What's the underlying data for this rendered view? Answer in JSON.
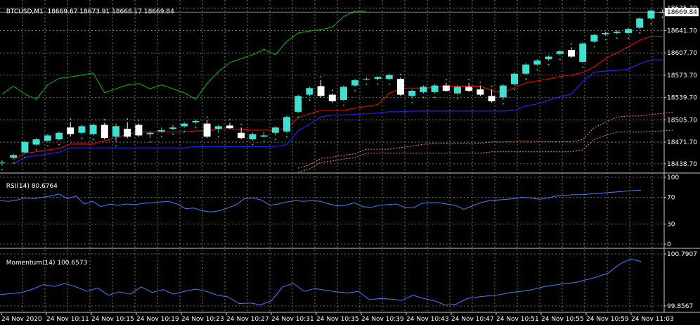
{
  "chart_data": [
    {
      "type": "candlestick",
      "title": "BTCUSD,M1  18669.67 18673.91 18668.17 18669.84",
      "current_price_label": "18669.84",
      "ylim": [
        18430,
        18685
      ],
      "y_ticks": [
        "18675.70",
        "18641.70",
        "18607.70",
        "18573.70",
        "18539.70",
        "18505.70",
        "18471.70",
        "18438.70"
      ],
      "series": [
        {
          "name": "BTCUSD,M1",
          "type": "candlestick",
          "ohlc": [
            [
              18440,
              18444,
              18436,
              18441
            ],
            [
              18448,
              18454,
              18446,
              18452
            ],
            [
              18456,
              18474,
              18454,
              18472
            ],
            [
              18468,
              18478,
              18466,
              18476
            ],
            [
              18474,
              18484,
              18472,
              18482
            ],
            [
              18476,
              18488,
              18474,
              18486
            ],
            [
              18494,
              18502,
              18480,
              18484
            ],
            [
              18486,
              18498,
              18484,
              18496
            ],
            [
              18484,
              18500,
              18482,
              18498
            ],
            [
              18498,
              18501,
              18476,
              18478
            ],
            [
              18480,
              18500,
              18472,
              18496
            ],
            [
              18492,
              18502,
              18478,
              18480
            ],
            [
              18498,
              18500,
              18480,
              18482
            ],
            [
              18484,
              18488,
              18478,
              18486
            ],
            [
              18488,
              18494,
              18486,
              18490
            ],
            [
              18492,
              18498,
              18490,
              18494
            ],
            [
              18496,
              18502,
              18494,
              18500
            ],
            [
              18502,
              18506,
              18500,
              18504
            ],
            [
              18500,
              18505,
              18478,
              18480
            ],
            [
              18492,
              18498,
              18486,
              18496
            ],
            [
              18497,
              18501,
              18492,
              18493
            ],
            [
              18486,
              18494,
              18476,
              18478
            ],
            [
              18476,
              18486,
              18474,
              18484
            ],
            [
              18480,
              18488,
              18479,
              18482
            ],
            [
              18486,
              18496,
              18482,
              18494
            ],
            [
              18488,
              18512,
              18486,
              18510
            ],
            [
              18518,
              18544,
              18516,
              18542
            ],
            [
              18544,
              18556,
              18542,
              18554
            ],
            [
              18557,
              18566,
              18540,
              18542
            ],
            [
              18544,
              18546,
              18532,
              18534
            ],
            [
              18536,
              18558,
              18534,
              18556
            ],
            [
              18558,
              18568,
              18556,
              18566
            ],
            [
              18568,
              18570,
              18566,
              18568
            ],
            [
              18568,
              18572,
              18566,
              18571
            ],
            [
              18568,
              18576,
              18566,
              18574
            ],
            [
              18568,
              18570,
              18542,
              18544
            ],
            [
              18542,
              18552,
              18538,
              18550
            ],
            [
              18548,
              18558,
              18546,
              18556
            ],
            [
              18548,
              18560,
              18546,
              18558
            ],
            [
              18558,
              18562,
              18548,
              18550
            ],
            [
              18546,
              18558,
              18544,
              18556
            ],
            [
              18556,
              18562,
              18548,
              18550
            ],
            [
              18552,
              18558,
              18542,
              18544
            ],
            [
              18542,
              18552,
              18532,
              18534
            ],
            [
              18540,
              18560,
              18536,
              18558
            ],
            [
              18560,
              18578,
              18558,
              18576
            ],
            [
              18576,
              18592,
              18574,
              18590
            ],
            [
              18590,
              18598,
              18588,
              18596
            ],
            [
              18598,
              18604,
              18596,
              18602
            ],
            [
              18606,
              18612,
              18604,
              18610
            ],
            [
              18612,
              18616,
              18600,
              18602
            ],
            [
              18594,
              18624,
              18592,
              18622
            ],
            [
              18625,
              18637,
              18623,
              18635
            ],
            [
              18636,
              18640,
              18634,
              18638
            ],
            [
              18638,
              18642,
              18636,
              18640
            ],
            [
              18638,
              18646,
              18636,
              18644
            ],
            [
              18646,
              18662,
              18644,
              18660
            ],
            [
              18660,
              18674,
              18658,
              18672
            ],
            [
              18669.67,
              18673.91,
              18668.17,
              18669.84
            ]
          ]
        },
        {
          "name": "Ichimoku Tenkan",
          "color": "#ff0000"
        },
        {
          "name": "Ichimoku Kijun",
          "color": "#0000ff"
        },
        {
          "name": "Chikou Span",
          "color": "#00c000"
        },
        {
          "name": "Senkou Span A/B",
          "color": "#ff8c40"
        },
        {
          "name": "Parabolic SAR",
          "color": "#00ff00"
        }
      ]
    },
    {
      "type": "line",
      "title": "RSI(14) 80.6764",
      "ylim": [
        0,
        100
      ],
      "y_ticks": [
        "100",
        "70",
        "30",
        "0"
      ],
      "series": [
        {
          "name": "RSI(14)",
          "color": "#3f7fff",
          "values": [
            65,
            64,
            66,
            69,
            68,
            70,
            72,
            75,
            68,
            72,
            60,
            64,
            56,
            60,
            58,
            60,
            59,
            61,
            62,
            63,
            64,
            60,
            53,
            54,
            50,
            48,
            50,
            54,
            59,
            68,
            69,
            66,
            58,
            60,
            63,
            65,
            64,
            65,
            64,
            60,
            57,
            58,
            62,
            56,
            55,
            58,
            59,
            60,
            55,
            54,
            61,
            62,
            62,
            60,
            58,
            52,
            57,
            62,
            65,
            66,
            67,
            68,
            70,
            69,
            67,
            69,
            72,
            73,
            74,
            74,
            75,
            76,
            77,
            78,
            79,
            80,
            80.6764
          ]
        }
      ]
    },
    {
      "type": "line",
      "title": "Momentum(14) 100.6573",
      "ylim": [
        99.8567,
        100.7907
      ],
      "y_ticks": [
        "100.7907",
        "99.8567"
      ],
      "series": [
        {
          "name": "Momentum(14)",
          "color": "#3f7fff",
          "values": [
            100.06,
            100.08,
            100.1,
            100.16,
            100.24,
            100.21,
            100.26,
            100.2,
            100.12,
            100.18,
            100.05,
            100.11,
            100.07,
            100.2,
            100.1,
            100.15,
            100.07,
            100.12,
            100.16,
            100.12,
            100.05,
            100.02,
            99.9,
            99.91,
            99.88,
            99.95,
            100.2,
            100.26,
            100.12,
            100.17,
            100.14,
            100.11,
            100.09,
            100.12,
            99.97,
            99.99,
            99.98,
            99.96,
            100.05,
            99.99,
            99.95,
            99.87,
            99.89,
            99.99,
            100.02,
            100.04,
            100.06,
            100.1,
            100.12,
            100.15,
            100.2,
            100.23,
            100.26,
            100.28,
            100.33,
            100.38,
            100.45,
            100.6,
            100.7,
            100.6573
          ]
        }
      ]
    }
  ],
  "time_axis": [
    "24 Nov 2020",
    "24 Nov 10:11",
    "24 Nov 10:15",
    "24 Nov 10:19",
    "24 Nov 10:23",
    "24 Nov 10:27",
    "24 Nov 10:31",
    "24 Nov 10:35",
    "24 Nov 10:39",
    "24 Nov 10:43",
    "24 Nov 10:47",
    "24 Nov 10:51",
    "24 Nov 10:55",
    "24 Nov 10:59",
    "24 Nov 11:03"
  ],
  "colors": {
    "bull": "#40e0d0",
    "bear": "#ffffff",
    "grid": "#c8c8c8",
    "background": "#000000"
  }
}
